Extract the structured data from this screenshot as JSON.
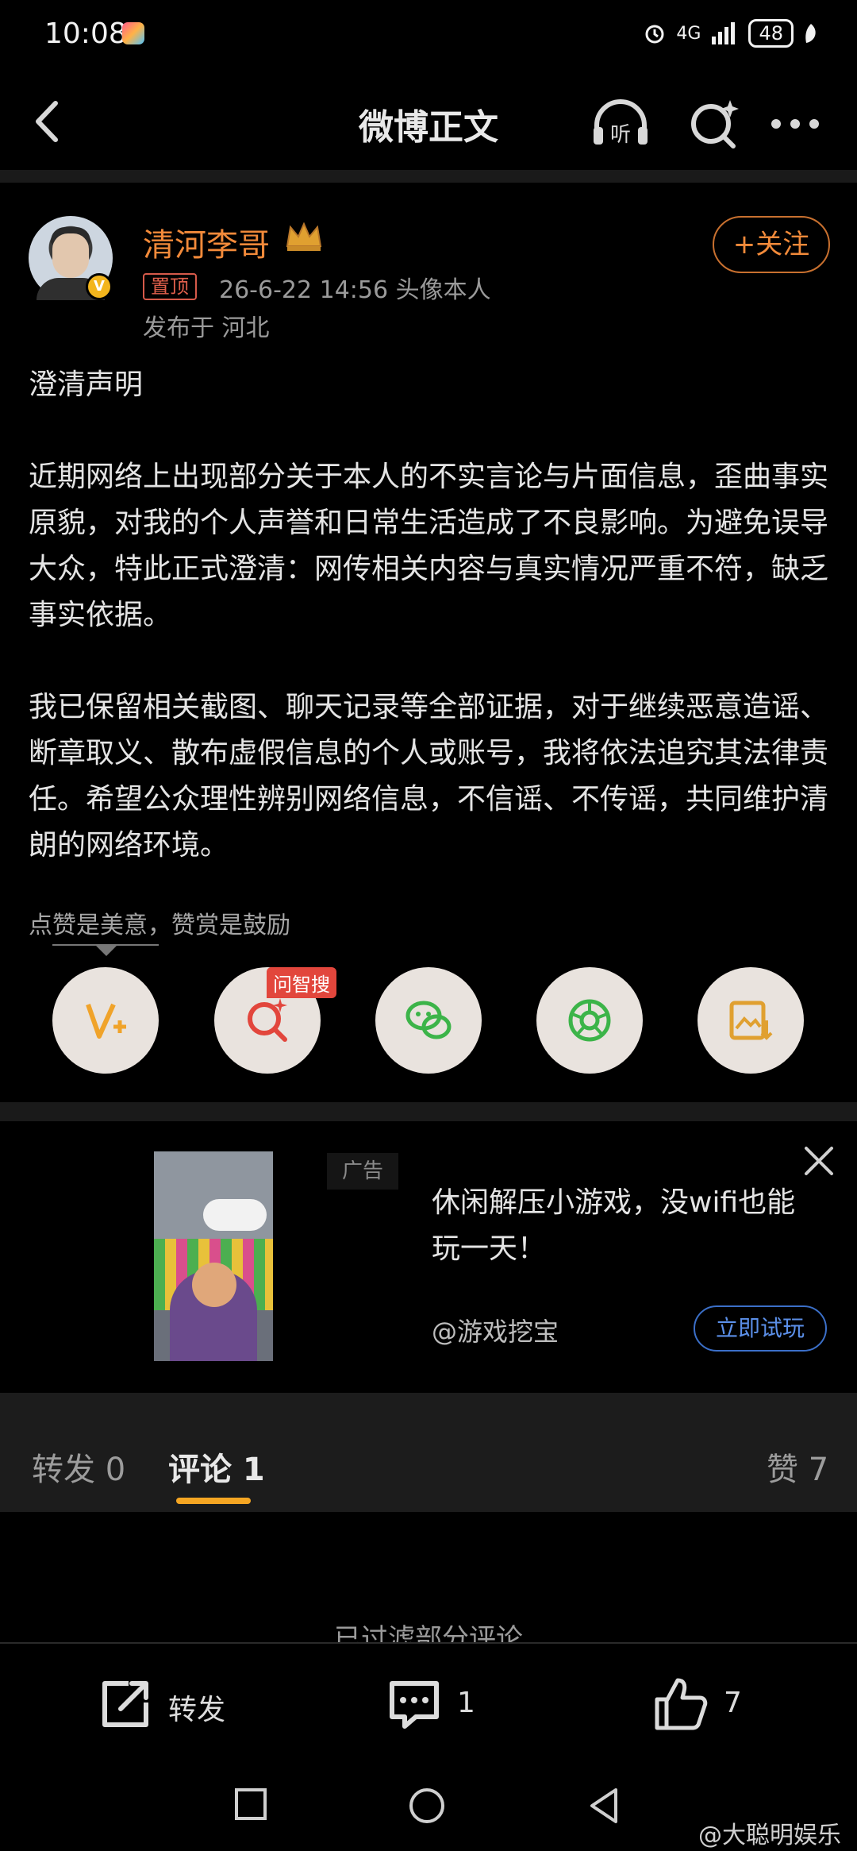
{
  "status_bar": {
    "time": "10:08",
    "network": "4G",
    "battery": "48"
  },
  "nav": {
    "title": "微博正文",
    "listen_label": "听"
  },
  "author": {
    "name": "清河李哥",
    "pin_label": "置顶",
    "meta": "26-6-22 14:56  头像本人",
    "location": "发布于 河北",
    "follow_label": "+关注",
    "verified_mark": "V"
  },
  "post": {
    "paragraphs": [
      "澄清声明",
      "近期网络上出现部分关于本人的不实言论与片面信息，歪曲事实原貌，对我的个人声誉和日常生活造成了不良影响。为避免误导大众，特此正式澄清：网传相关内容与真实情况严重不符，缺乏事实依据。",
      "我已保留相关截图、聊天记录等全部证据，对于继续恶意造谣、断章取义、散布虚假信息的个人或账号，我将依法追究其法律责任。希望公众理性辨别网络信息，不信谣、不传谣，共同维护清朗的网络环境。"
    ]
  },
  "reward": {
    "text": "点赞是美意，赞赏是鼓励",
    "wen_tag": "问智搜"
  },
  "share_buttons": [
    "reward-icon",
    "search-ai-icon",
    "wechat-icon",
    "moments-icon",
    "save-image-icon"
  ],
  "ad": {
    "tag": "广告",
    "title": "休闲解压小游戏，没wifi也能玩一天！",
    "source": "@游戏挖宝",
    "cta": "立即试玩"
  },
  "tabs": {
    "repost": "转发 0",
    "comment": "评论 1",
    "like": "赞 7"
  },
  "comments_note": "已过滤部分评论",
  "actions": {
    "repost": "转发",
    "comment_count": "1",
    "like_count": "7"
  },
  "watermark": "@大聪明娱乐",
  "colors": {
    "accent": "#f28a3a",
    "tab_underline": "#f5a623",
    "link": "#5b8fe8"
  }
}
